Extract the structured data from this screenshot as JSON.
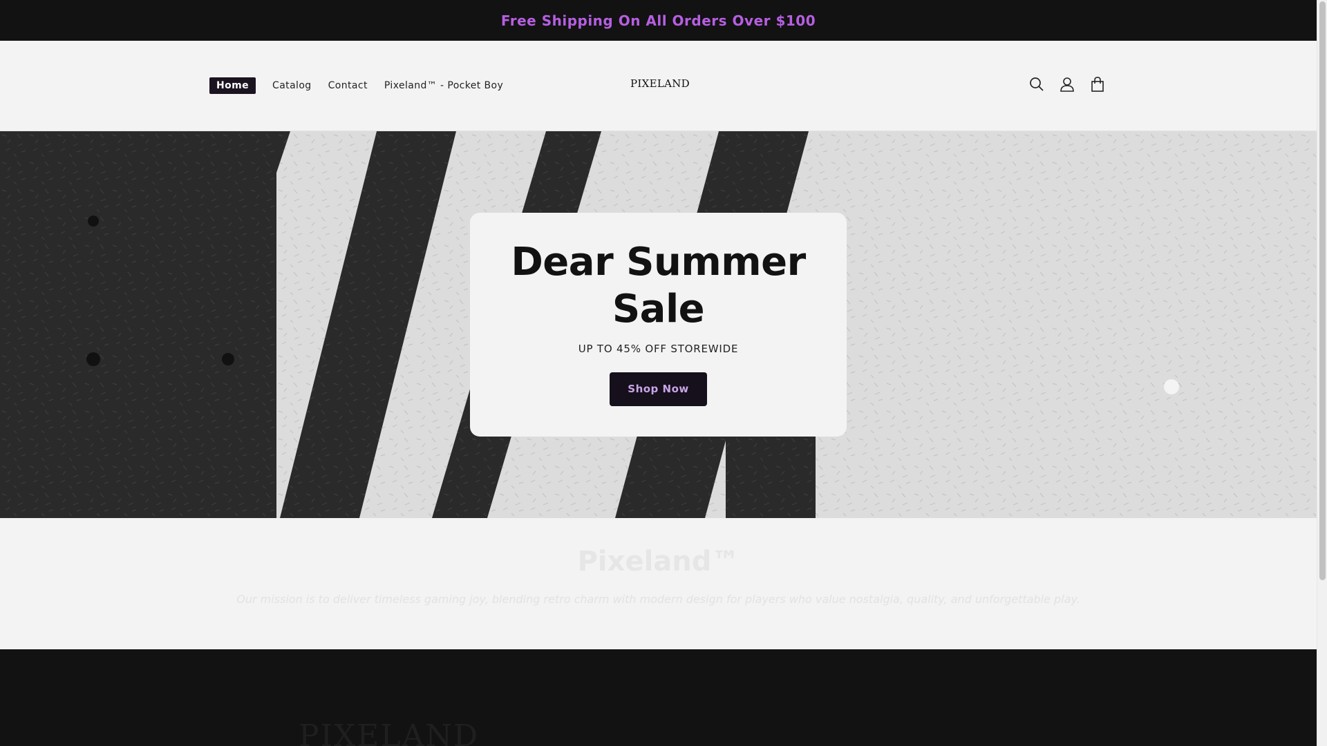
{
  "announcement": {
    "text": "Free Shipping On All Orders Over $100"
  },
  "header": {
    "nav": [
      {
        "label": "Home",
        "active": true
      },
      {
        "label": "Catalog"
      },
      {
        "label": "Contact"
      },
      {
        "label": "Pixeland™ - Pocket Boy"
      }
    ],
    "logo": "PIXELAND",
    "icons": [
      "search-icon",
      "account-icon",
      "cart-icon"
    ]
  },
  "hero": {
    "title_line1": "Dear Summer",
    "title_line2": "Sale",
    "subtitle": "UP TO 45% OFF STOREWIDE",
    "button": "Shop Now"
  },
  "brand": {
    "title": "Pixeland™",
    "text": "Our mission is to deliver timeless gaming joy, blending retro charm with modern design for players who value nostalgia, quality, and unforgettable play."
  },
  "footer": {
    "text": "PIXELAND"
  },
  "colors": {
    "accent": "#b65fe2",
    "dark": "#121212",
    "button": "#160f1c"
  }
}
